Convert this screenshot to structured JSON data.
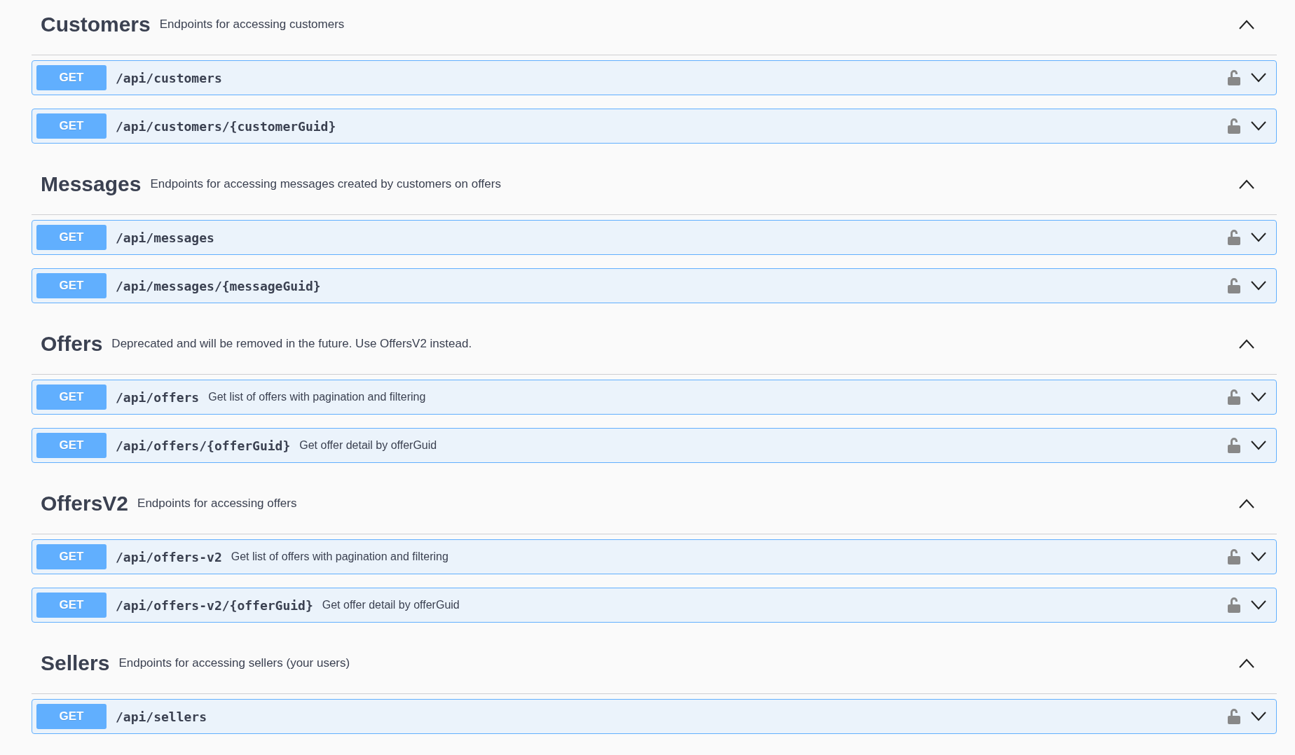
{
  "sections": [
    {
      "name": "Customers",
      "description": "Endpoints for accessing customers",
      "expanded": true,
      "operations": [
        {
          "method": "GET",
          "path": "/api/customers",
          "expanded": false
        },
        {
          "method": "GET",
          "path": "/api/customers/{customerGuid}",
          "expanded": false
        }
      ]
    },
    {
      "name": "Messages",
      "description": "Endpoints for accessing messages created by customers on offers",
      "expanded": true,
      "operations": [
        {
          "method": "GET",
          "path": "/api/messages",
          "expanded": false
        },
        {
          "method": "GET",
          "path": "/api/messages/{messageGuid}",
          "expanded": false
        }
      ]
    },
    {
      "name": "Offers",
      "description": "Deprecated and will be removed in the future. Use OffersV2 instead.",
      "expanded": true,
      "operations": [
        {
          "method": "GET",
          "path": "/api/offers",
          "summary": "Get list of offers with pagination and filtering",
          "expanded": false
        },
        {
          "method": "GET",
          "path": "/api/offers/{offerGuid}",
          "summary": "Get offer detail by offerGuid",
          "expanded": false
        }
      ]
    },
    {
      "name": "OffersV2",
      "description": "Endpoints for accessing offers",
      "expanded": true,
      "operations": [
        {
          "method": "GET",
          "path": "/api/offers-v2",
          "summary": "Get list of offers with pagination and filtering",
          "expanded": false
        },
        {
          "method": "GET",
          "path": "/api/offers-v2/{offerGuid}",
          "summary": "Get offer detail by offerGuid",
          "expanded": false
        }
      ]
    },
    {
      "name": "Sellers",
      "description": "Endpoints for accessing sellers (your users)",
      "expanded": true,
      "operations": [
        {
          "method": "GET",
          "path": "/api/sellers",
          "expanded": false
        }
      ]
    }
  ]
}
